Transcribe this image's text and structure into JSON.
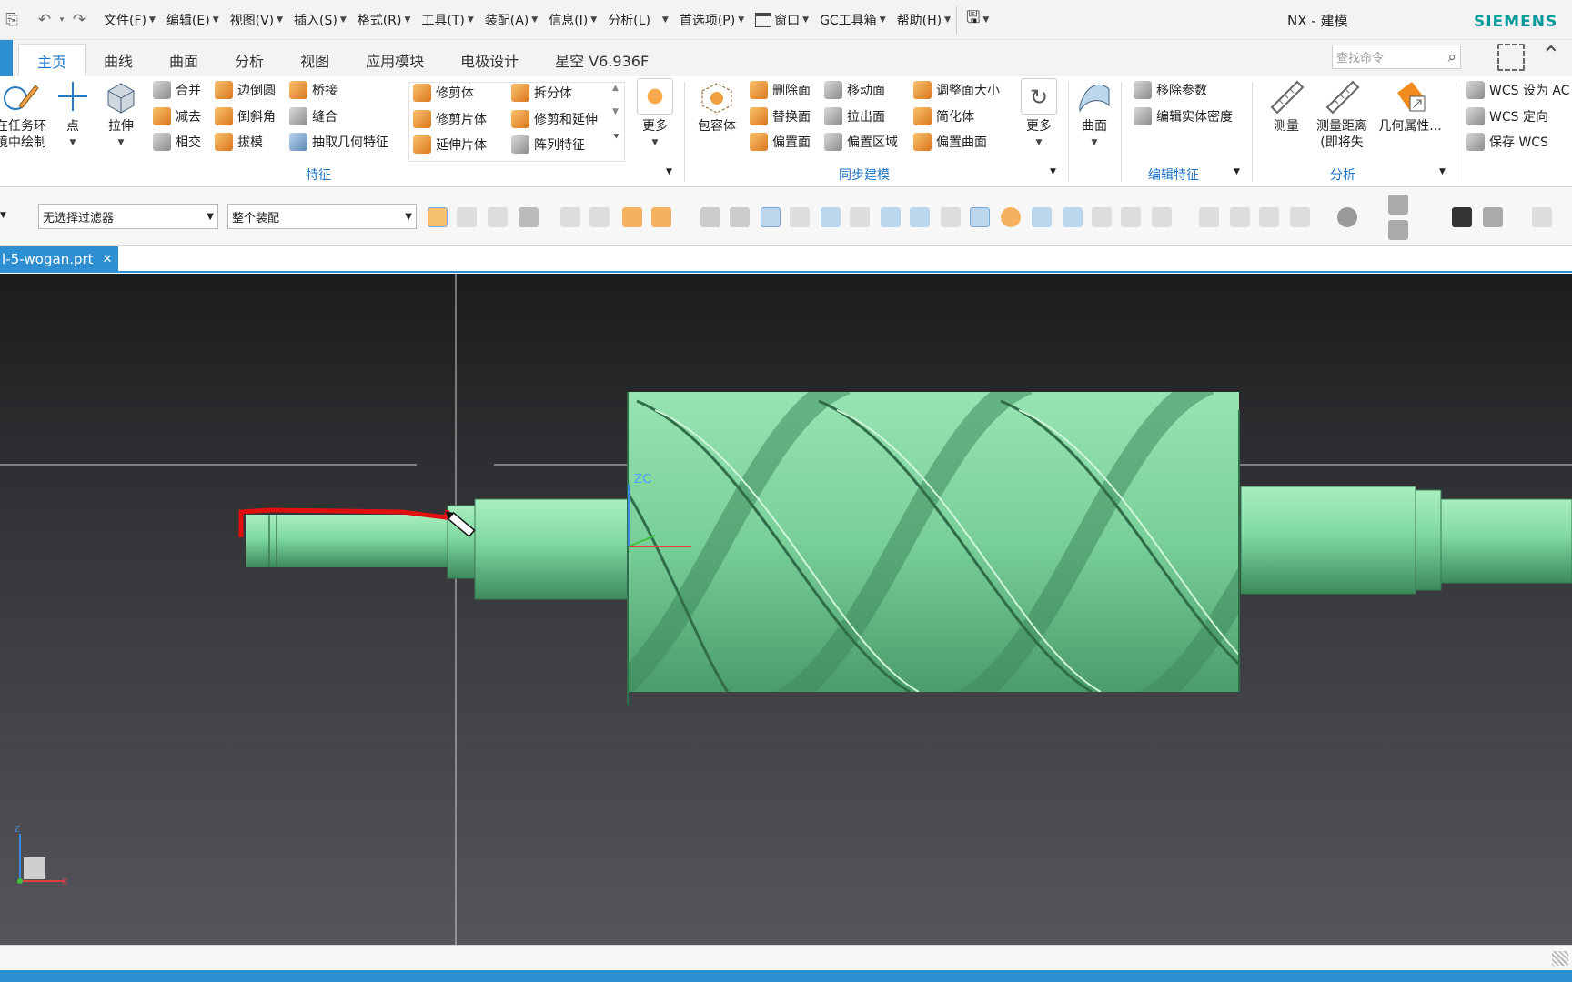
{
  "window": {
    "app_title": "NX - 建模",
    "brand": "SIEMENS"
  },
  "menu": [
    "文件(F)",
    "编辑(E)",
    "视图(V)",
    "插入(S)",
    "格式(R)",
    "工具(T)",
    "装配(A)",
    "信息(I)",
    "分析(L)",
    "首选项(P)",
    "窗口",
    "GC工具箱",
    "帮助(H)"
  ],
  "tabs": [
    "主页",
    "曲线",
    "曲面",
    "分析",
    "视图",
    "应用模块",
    "电极设计",
    "星空 V6.936F"
  ],
  "search": {
    "placeholder": "查找命令"
  },
  "ribbon": {
    "task_env_line1": "在任务环",
    "task_env_line2": "境中绘制",
    "point": "点",
    "extrude": "拉伸",
    "unite": "合并",
    "subtract": "减去",
    "intersect": "相交",
    "edge_blend": "边倒圆",
    "chamfer": "倒斜角",
    "draft": "拔模",
    "bridge": "桥接",
    "sew": "缝合",
    "extract_geom": "抽取几何特征",
    "trim_body": "修剪体",
    "trim_sheet": "修剪片体",
    "extend_sheet": "延伸片体",
    "split_body": "拆分体",
    "trim_extend": "修剪和延伸",
    "pattern_feature": "阵列特征",
    "more_1": "更多",
    "feature_group": "特征",
    "bounding_body": "包容体",
    "delete_face": "删除面",
    "replace_face": "替换面",
    "offset_face": "偏置面",
    "move_face": "移动面",
    "pull_face": "拉出面",
    "offset_region": "偏置区域",
    "resize_face": "调整面大小",
    "simplify": "简化体",
    "offset_surface": "偏置曲面",
    "more_2": "更多",
    "sync_group": "同步建模",
    "surface": "曲面",
    "remove_params": "移除参数",
    "edit_density": "编辑实体密度",
    "edit_feature_group": "编辑特征",
    "measure": "测量",
    "measure_dist_1": "测量距离",
    "measure_dist_2": "(即将失",
    "geom_props": "几何属性...",
    "analysis_group": "分析",
    "wcs_set": "WCS 设为 AC",
    "wcs_orient": "WCS 定向",
    "wcs_save": "保存 WCS"
  },
  "filter": {
    "selection_filter": "无选择过滤器",
    "assembly_scope": "整个装配"
  },
  "document": {
    "tab_label": "l-5-wogan.prt",
    "close": "✕"
  },
  "viewport": {
    "csys_label": "ZC",
    "triad_z": "Z",
    "triad_x": "X"
  },
  "colors": {
    "accent": "#2e8fd2",
    "brand": "#009999",
    "model_green": "#7fd8a0",
    "sketch_red": "#e01010"
  }
}
